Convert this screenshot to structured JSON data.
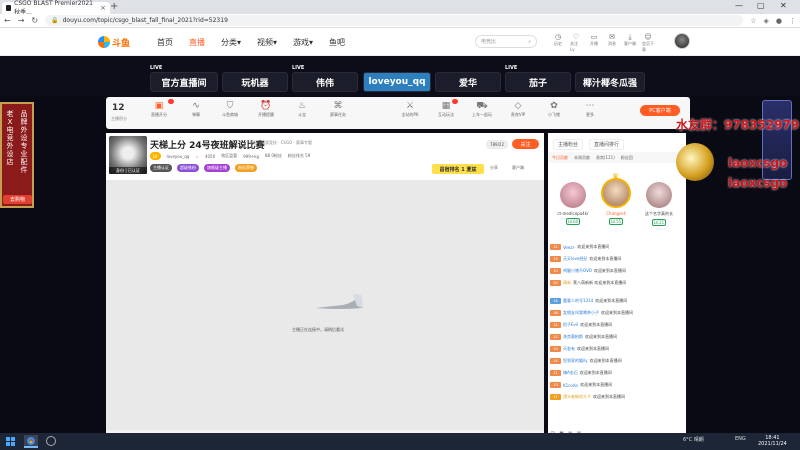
{
  "browser": {
    "tab_title": "CSGO BLAST Premier2021秋季...",
    "url": "douyu.com/topic/csgo_blast_fall_final_2021?rid=52319"
  },
  "site": {
    "logo_text": "斗鱼",
    "nav": [
      "首页",
      "直播",
      "分类▾",
      "视频▾",
      "游戏▾",
      "鱼吧"
    ],
    "search_placeholder": "电竞比",
    "header_icons": [
      {
        "icon": "history-icon",
        "label": "历史"
      },
      {
        "icon": "user-icon",
        "label": "关注 Lv"
      },
      {
        "icon": "video-icon",
        "label": "开播"
      },
      {
        "icon": "message-icon",
        "label": "消息"
      },
      {
        "icon": "download-icon",
        "label": "客户端"
      },
      {
        "icon": "app-icon",
        "label": "会员下载"
      }
    ]
  },
  "channels": [
    {
      "label": "官方直播间",
      "live": "LIVE"
    },
    {
      "label": "玩机器",
      "live": ""
    },
    {
      "label": "伟伟",
      "live": "LIVE"
    },
    {
      "label": "loveyou_qq",
      "live": ""
    },
    {
      "label": "爱华",
      "live": ""
    },
    {
      "label": "茄子",
      "live": "LIVE"
    },
    {
      "label": "椰汁椰冬瓜强",
      "live": ""
    }
  ],
  "room_tools": {
    "level": "12",
    "level_label": "主播积分",
    "items": [
      "直播开分",
      "弹幕",
      "斗鱼商城",
      "开播提醒",
      "斗宝",
      "赛事任务",
      "全站的PK",
      "互动玩法",
      "上车一起玩",
      "贵宾VIP",
      "小飞猪",
      "更多"
    ],
    "pc_button": "PC客户端"
  },
  "left_ad": {
    "col1": "老X电竞外设店",
    "col2": "品牌外设专业配件",
    "button": "去购物"
  },
  "room": {
    "title": "天梯上分 24号夜班解说比赛",
    "subtitle": "举报 · 网游竞技 · CSGO · 赛事专题",
    "streamer": "loveyou_qq",
    "fans_count": "4050",
    "meta": [
      "地区监管",
      "999+kg",
      "88 0粉丝",
      "粉丝排名 59"
    ],
    "follow": "关注",
    "fans_btn": "789/22",
    "tags": [
      "主播认证",
      "超级铁粉",
      "旗舰级主播",
      "粉丝荣誉"
    ],
    "rank": "昌宿排名 1 夏兹",
    "share": "分享",
    "report": "客户端",
    "avatar_tag": "身份 | 已认证",
    "status": "主播正在连接中，请稍后重试"
  },
  "right_panel": {
    "tabs_top": [
      "主播粉丝",
      "直播间排行"
    ],
    "tabs": [
      "今日贡献",
      "本周贡献",
      "贵宾(121)",
      "粉丝团"
    ],
    "top_fans": [
      {
        "name": "ct-medicopa4kr",
        "level": "LV.60",
        "color": "#e9a9b8"
      },
      {
        "name": "Changer4",
        "level": "LV.55",
        "color": "#e8c0a0"
      },
      {
        "name": "这个名字真的长",
        "level": "LV.21",
        "color": "#e9d0d0"
      }
    ],
    "chat": [
      {
        "lv": "12",
        "name": "Veezr-",
        "text": "欢迎来到本直播间"
      },
      {
        "lv": "15",
        "name": "天天love经纪",
        "text": "欢迎来到本直播间"
      },
      {
        "lv": "10",
        "name": "鸡腿小猪不OVO",
        "text": "欢迎来到本直播间"
      },
      {
        "lv": "20",
        "name": "萌新",
        "text": "莱八萌新新 欢迎来到本直播间"
      },
      {
        "lv": "18",
        "name": "重要人的号1314",
        "text": "欢迎来到本直播间"
      },
      {
        "lv": "16",
        "name": "女朋友叫我喝茶小子",
        "text": "欢迎来到本直播间"
      },
      {
        "lv": "12",
        "name": "恒子Evil",
        "text": "欢迎来到本直播间"
      },
      {
        "lv": "12",
        "name": "洛克赛柏斯",
        "text": "欢迎来到本直播间"
      },
      {
        "lv": "19",
        "name": "天若有",
        "text": "欢迎来到本直播间"
      },
      {
        "lv": "14",
        "name": "您到家的猫ily",
        "text": "欢迎来到本直播间"
      },
      {
        "lv": "11",
        "name": "嗨A金石",
        "text": "欢迎来到本直播间"
      },
      {
        "lv": "13",
        "name": "K1coAn",
        "text": "欢迎来到本直播间"
      },
      {
        "lv": "17",
        "name": "漂头被偷窃大子",
        "text": "欢迎来到本直播间"
      }
    ]
  },
  "overlay": {
    "qq_group": "水友群：978352979",
    "line2": "laoxcsgo",
    "line3": "laoxcsgo"
  },
  "taskbar": {
    "weather": "6°C 晴朗",
    "lang": "ENG",
    "time": "18:41",
    "date": "2021/11/24"
  },
  "colors": {
    "accent": "#ff5d23",
    "channel_active": "#2d7fbd",
    "overlay_red": "#d0141e"
  }
}
